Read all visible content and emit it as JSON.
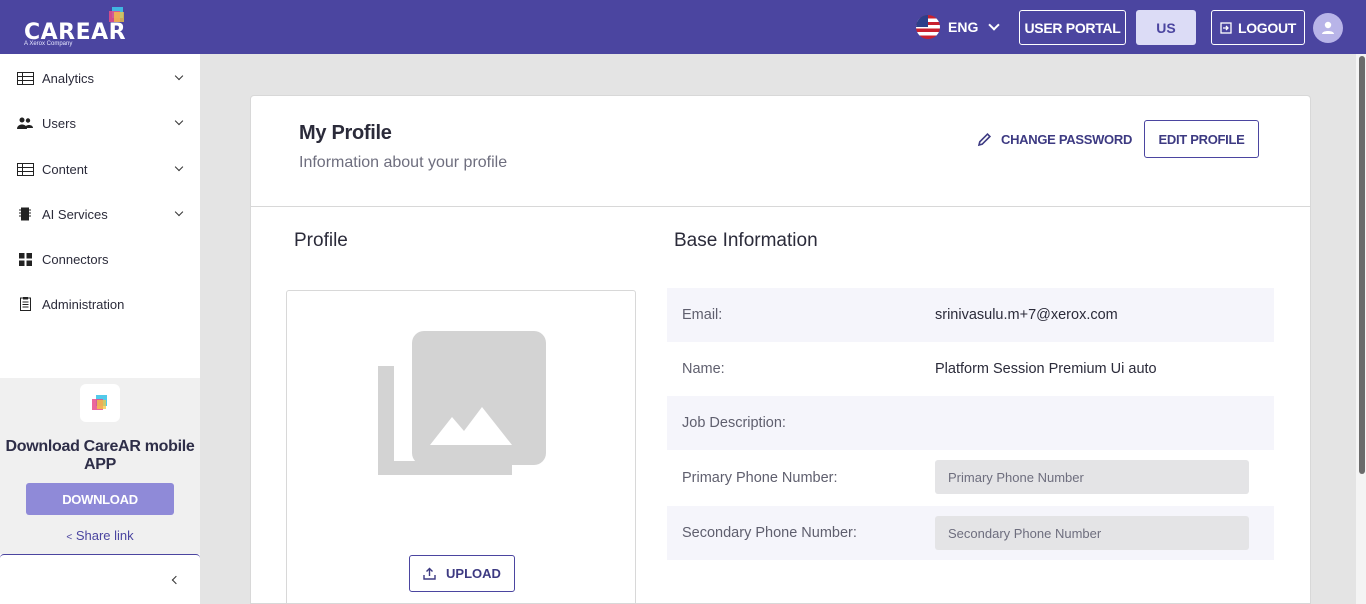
{
  "header": {
    "logo_text": "CAREAR",
    "logo_tagline": "A Xerox Company",
    "language": "ENG",
    "user_portal_label": "USER PORTAL",
    "region_label": "US",
    "logout_label": "LOGOUT",
    "colors": {
      "bar": "#4b45a0",
      "region_button": "#dcdcf6"
    }
  },
  "sidebar": {
    "items": [
      {
        "label": "Analytics",
        "icon": "table-icon",
        "expandable": true
      },
      {
        "label": "Users",
        "icon": "users-icon",
        "expandable": true
      },
      {
        "label": "Content",
        "icon": "table-icon",
        "expandable": true
      },
      {
        "label": "AI Services",
        "icon": "chip-icon",
        "expandable": true
      },
      {
        "label": "Connectors",
        "icon": "grid-icon",
        "expandable": false
      },
      {
        "label": "Administration",
        "icon": "clipboard-icon",
        "expandable": false
      }
    ],
    "promo": {
      "title": "Download CareAR mobile APP",
      "download_label": "DOWNLOAD",
      "share_label": "Share link"
    }
  },
  "page": {
    "title": "My Profile",
    "subtitle": "Information about your profile",
    "change_password_label": "CHANGE PASSWORD",
    "edit_profile_label": "EDIT PROFILE",
    "profile_section_title": "Profile",
    "upload_label": "UPLOAD",
    "base_section_title": "Base Information",
    "fields": {
      "email": {
        "label": "Email:",
        "value": "srinivasulu.m+7@xerox.com"
      },
      "name": {
        "label": "Name:",
        "value": "Platform Session Premium Ui auto"
      },
      "job": {
        "label": "Job Description:",
        "value": ""
      },
      "primary_phone": {
        "label": "Primary Phone Number:",
        "value": "",
        "placeholder": "Primary Phone Number"
      },
      "secondary_phone": {
        "label": "Secondary Phone Number:",
        "value": "",
        "placeholder": "Secondary Phone Number"
      }
    }
  }
}
